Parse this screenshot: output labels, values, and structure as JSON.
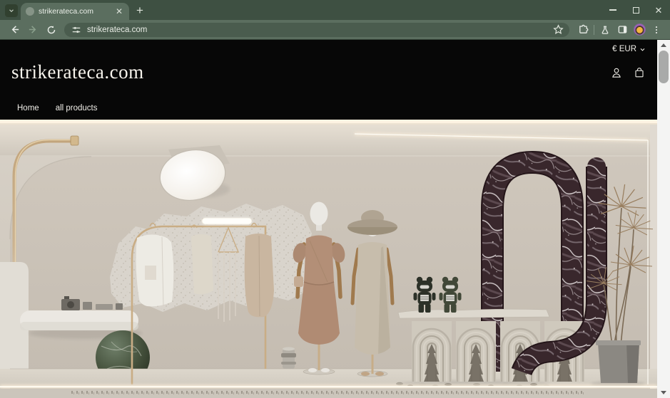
{
  "browser": {
    "tab_title": "strikerateca.com",
    "url": "strikerateca.com",
    "icons": {
      "tab_search": "chevron-down",
      "new_tab": "plus",
      "back": "arrow-left",
      "forward": "arrow-right",
      "reload": "reload-circle",
      "site_info": "tune-sliders",
      "bookmark": "star-outline",
      "extensions": "puzzle",
      "labs": "flask",
      "side_panel": "split-square",
      "profile": "avatar",
      "menu": "kebab-dots",
      "minimize": "bar",
      "maximize": "square-outline",
      "close": "x"
    },
    "theme": {
      "tabstrip_bg": "#3e5042",
      "toolbar_bg": "#5b6e5f",
      "urlbar_bg": "#4a5c4e"
    }
  },
  "site": {
    "currency_label": "€ EUR",
    "logo": "strikerateca.com",
    "nav": [
      {
        "label": "Home"
      },
      {
        "label": "all products"
      }
    ],
    "header_bg": "#070707",
    "icons": {
      "account": "person-outline",
      "cart": "shopping-bag"
    }
  },
  "hero": {
    "alt": "Beige boutique display: brass clothes rack with garments, two mannequins (tan dress; hat with knit dress), two dark bear figures on an arched stone console, burgundy marble arch sculpture, tall potted plant, green marble sphere under a white shelf, glowing light strips",
    "palette": {
      "wall": "#cbc3b8",
      "floor": "#d6d0c5",
      "marble": "#3a282d",
      "brass": "#c3a67e",
      "glow": "#fff3de"
    }
  }
}
